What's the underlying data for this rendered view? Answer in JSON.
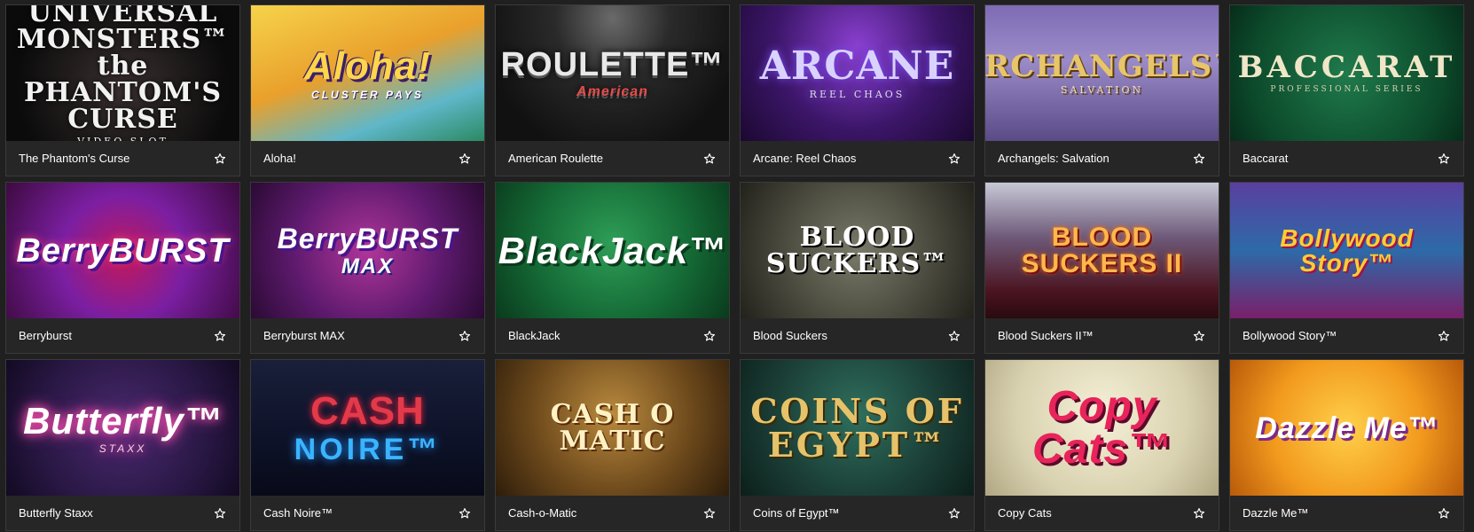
{
  "games": [
    {
      "name": "The Phantom's Curse",
      "art_title": "UNIVERSAL MONSTERS™ the PHANTOM'S CURSE",
      "art_sub": "VIDEO SLOT"
    },
    {
      "name": "Aloha!",
      "art_title": "Aloha!",
      "art_sub": "CLUSTER PAYS"
    },
    {
      "name": "American Roulette",
      "art_title": "ROULETTE™",
      "art_sub": "American"
    },
    {
      "name": "Arcane: Reel Chaos",
      "art_title": "ARCANE",
      "art_sub": "REEL CHAOS"
    },
    {
      "name": "Archangels: Salvation",
      "art_title": "ARCHANGELS™",
      "art_sub": "SALVATION"
    },
    {
      "name": "Baccarat",
      "art_title": "BACCARAT",
      "art_sub": "PROFESSIONAL SERIES"
    },
    {
      "name": "Berryburst",
      "art_title": "BerryBURST",
      "art_sub": ""
    },
    {
      "name": "Berryburst MAX",
      "art_title": "BerryBURST",
      "art_sub": "MAX"
    },
    {
      "name": "BlackJack",
      "art_title": "BlackJack™",
      "art_sub": ""
    },
    {
      "name": "Blood Suckers",
      "art_title": "BLOOD SUCKERS™",
      "art_sub": ""
    },
    {
      "name": "Blood Suckers II™",
      "art_title": "BLOOD SUCKERS II",
      "art_sub": ""
    },
    {
      "name": "Bollywood Story™",
      "art_title": "Bollywood Story™",
      "art_sub": ""
    },
    {
      "name": "Butterfly Staxx",
      "art_title": "Butterfly™",
      "art_sub": "STAXX"
    },
    {
      "name": "Cash Noire™",
      "art_title": "CASH",
      "art_sub": "NOIRE™"
    },
    {
      "name": "Cash-o-Matic",
      "art_title": "CASH O MATIC",
      "art_sub": ""
    },
    {
      "name": "Coins of Egypt™",
      "art_title": "COINS OF EGYPT™",
      "art_sub": ""
    },
    {
      "name": "Copy Cats",
      "art_title": "Copy Cats™",
      "art_sub": ""
    },
    {
      "name": "Dazzle Me™",
      "art_title": "Dazzle Me™",
      "art_sub": ""
    }
  ],
  "icons": {
    "favorite": "star-outline-icon"
  },
  "colors": {
    "page_background": "#202020",
    "card_caption_background": "#262626",
    "caption_text": "#ffffff",
    "star_icon": "#ffffff"
  }
}
